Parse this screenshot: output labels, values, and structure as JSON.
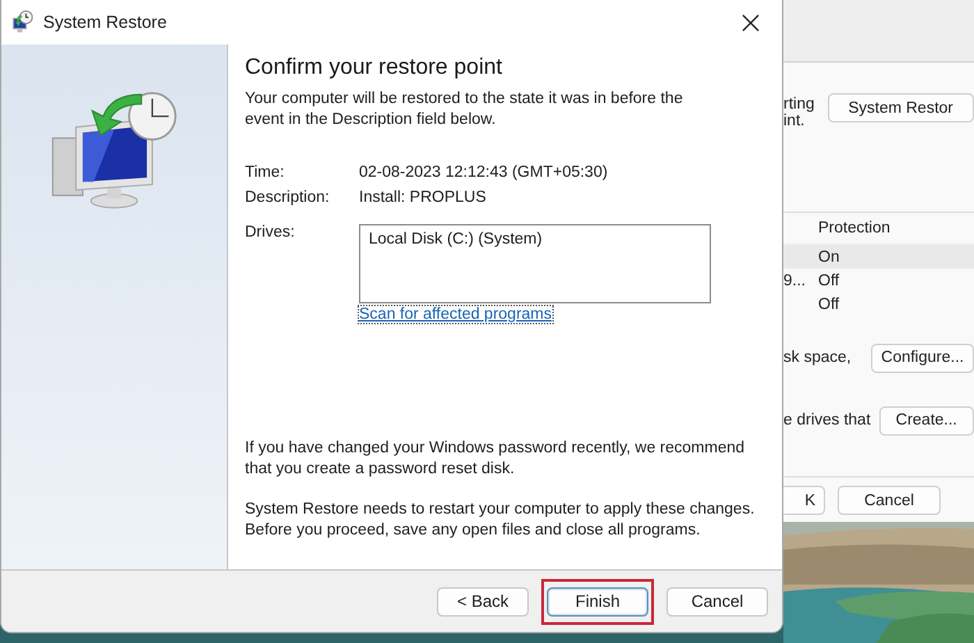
{
  "background_window": {
    "partial_text": [
      "rting",
      "int."
    ],
    "system_restore_button": "System Restor",
    "table": {
      "column": "Protection",
      "rows": [
        {
          "cells": [
            "",
            "On"
          ],
          "selected": true
        },
        {
          "cells": [
            "9...",
            "Off"
          ],
          "selected": false
        },
        {
          "cells": [
            "",
            "Off"
          ],
          "selected": false
        }
      ]
    },
    "disk_space_text": "sk space,",
    "configure_button": "Configure...",
    "drives_text": "e drives that",
    "create_button": "Create...",
    "buttons": [
      "K",
      "Cancel"
    ]
  },
  "dialog": {
    "title": "System Restore",
    "heading": "Confirm your restore point",
    "intro": "Your computer will be restored to the state it was in before the event in the Description field below.",
    "fields": [
      {
        "label": "Time:",
        "value": "02-08-2023 12:12:43 (GMT+05:30)"
      },
      {
        "label": "Description:",
        "value": "Install: PROPLUS"
      }
    ],
    "drives_label": "Drives:",
    "drives": [
      "Local Disk (C:) (System)"
    ],
    "scan_link": "Scan for affected programs",
    "password_note": "If you have changed your Windows password recently, we recommend that you create a password reset disk.",
    "restart_note": "System Restore needs to restart your computer to apply these changes. Before you proceed, save any open files and close all programs.",
    "buttons": [
      {
        "label": "< Back",
        "highlighted": false,
        "default": false
      },
      {
        "label": "Finish",
        "highlighted": true,
        "default": true
      },
      {
        "label": "Cancel",
        "highlighted": false,
        "default": false
      }
    ]
  }
}
